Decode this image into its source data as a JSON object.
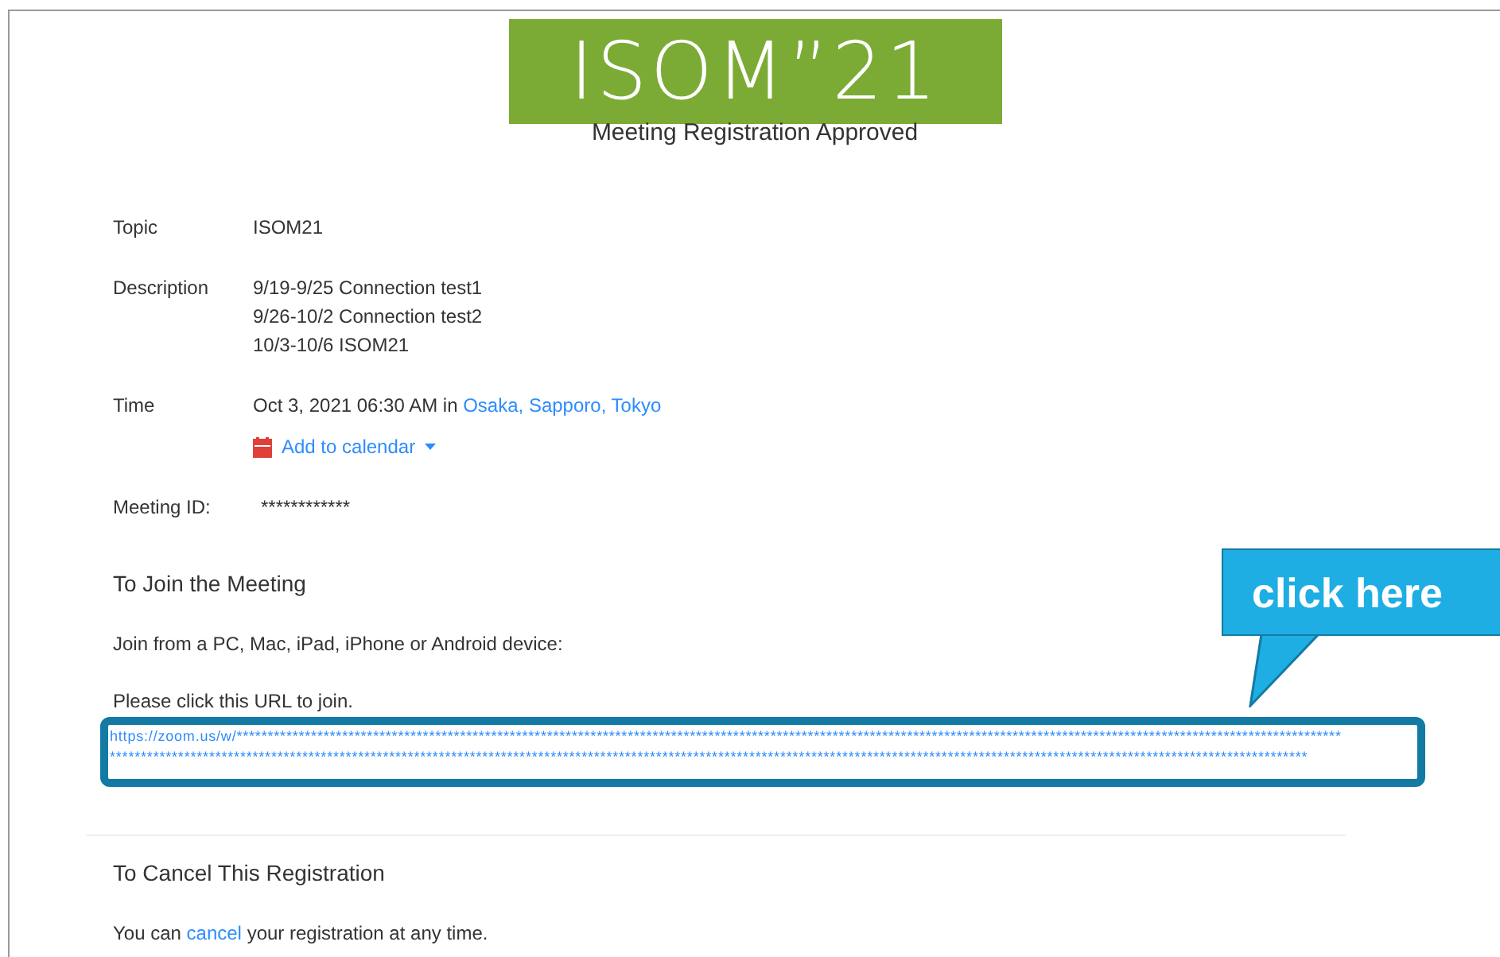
{
  "logo": {
    "text": "ISOM”21"
  },
  "heading": "Meeting Registration Approved",
  "details": [
    {
      "kind": "text",
      "label": "Topic",
      "lines": [
        "ISOM21"
      ]
    },
    {
      "kind": "text",
      "label": "Description",
      "lines": [
        "9/19-9/25 Connection test1",
        "9/26-10/2 Connection test2",
        "10/3-10/6 ISOM21"
      ]
    },
    {
      "kind": "time",
      "label": "Time",
      "value": "Oct 3, 2021 06:30 AM in",
      "timezone": "Osaka, Sapporo, Tokyo",
      "calendar_link": "Add to calendar"
    },
    {
      "kind": "id",
      "label": "Meeting ID:",
      "lines": [
        "************"
      ]
    }
  ],
  "join": {
    "title": "To Join the Meeting",
    "devices": "Join from a PC, Mac, iPad, iPhone or Android device:",
    "instruction": "Please click this URL to join.",
    "url_lines": [
      "https://zoom.us/w/**********************************************************************************************************************************************************************************",
      "*************************************************************************************************************************************************************************************************"
    ]
  },
  "callout": {
    "text": "click here"
  },
  "cancel": {
    "title": "To Cancel This Registration",
    "before": "You can",
    "link": "cancel",
    "after": "your registration at any time."
  }
}
